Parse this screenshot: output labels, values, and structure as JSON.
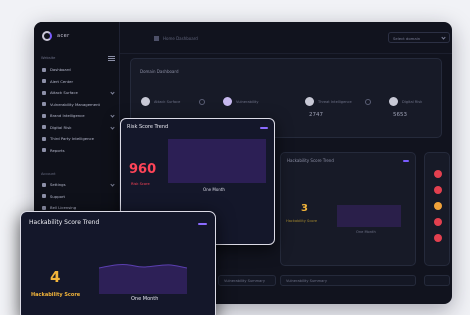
{
  "app": {
    "brand_name": "acer"
  },
  "sidebar": {
    "section_main": "Website",
    "items": [
      {
        "label": "Dashboard"
      },
      {
        "label": "Alert Center"
      },
      {
        "label": "Attack Surface"
      },
      {
        "label": "Vulnerability Management"
      },
      {
        "label": "Brand Intelligence"
      },
      {
        "label": "Digital Risk"
      },
      {
        "label": "Third Party Intelligence"
      },
      {
        "label": "Reports"
      }
    ],
    "section_account": "Account",
    "account_items": [
      {
        "label": "Settings"
      },
      {
        "label": "Support"
      },
      {
        "label": "Bell Licensing"
      }
    ]
  },
  "topbar": {
    "breadcrumb": "Home Dashboard",
    "select_value": "Select domain"
  },
  "summary": {
    "title": "Domain Dashboard",
    "metrics": [
      {
        "label": "Attack Surface",
        "value": ""
      },
      {
        "label": "Vulnerability",
        "value": ""
      },
      {
        "label": "Threat Intelligence",
        "value": "2747"
      },
      {
        "label": "Digital Risk",
        "value": "5653"
      }
    ]
  },
  "panels": {
    "hackability_mini_title": "Hackability Score Trend",
    "hackability_mini_value": "3",
    "hackability_mini_caption": "Hackability Score",
    "hackability_mini_xlabel": "One Month",
    "footer_left": "Vulnerability Summary",
    "footer_right": "Vulnerability Summary"
  },
  "status_colors": [
    "#e3404f",
    "#e3404f",
    "#f0a23a",
    "#e3404f",
    "#e3404f"
  ],
  "risk_card": {
    "title": "Risk Score Trend",
    "value": "960",
    "caption": "Risk Score",
    "xlabel": "One Month",
    "accent": "#ff4458"
  },
  "hackability_card": {
    "title": "Hackability Score Trend",
    "value": "4",
    "caption": "Hackability Score",
    "xlabel": "One Month",
    "accent": "#f2b43a"
  }
}
